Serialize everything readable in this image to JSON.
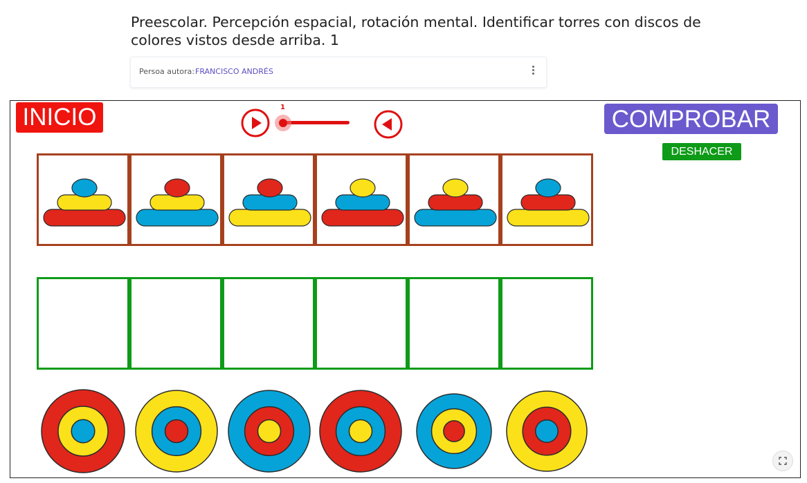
{
  "page": {
    "title": "Preescolar. Percepción espacial, rotación mental. Identificar torres con discos de colores vistos desde arriba. 1",
    "author_label": "Persoa autora:",
    "author_name": "FRANCISCO ANDRÉS"
  },
  "toolbar": {
    "start_label": "INICIO",
    "check_label": "COMPROBAR",
    "undo_label": "DESHACER",
    "slider_value": "1",
    "slider_level": 0
  },
  "colors": {
    "red": "#e1261c",
    "yellow": "#fbe11a",
    "blue": "#06a3d8",
    "tower_border": "#a5411e",
    "drop_border": "#0e9b18",
    "start_button": "#f0140f",
    "check_button": "#6a5acd",
    "undo_button": "#0e9b18"
  },
  "towers": [
    {
      "top": "blue",
      "middle": "yellow",
      "bottom": "red"
    },
    {
      "top": "red",
      "middle": "yellow",
      "bottom": "blue"
    },
    {
      "top": "red",
      "middle": "blue",
      "bottom": "yellow"
    },
    {
      "top": "yellow",
      "middle": "blue",
      "bottom": "red"
    },
    {
      "top": "yellow",
      "middle": "red",
      "bottom": "blue"
    },
    {
      "top": "blue",
      "middle": "red",
      "bottom": "yellow"
    }
  ],
  "top_views": [
    {
      "outer": "red",
      "middle": "yellow",
      "inner": "blue"
    },
    {
      "outer": "yellow",
      "middle": "blue",
      "inner": "red"
    },
    {
      "outer": "blue",
      "middle": "red",
      "inner": "yellow"
    },
    {
      "outer": "red",
      "middle": "blue",
      "inner": "yellow"
    },
    {
      "outer": "blue",
      "middle": "yellow",
      "inner": "red"
    },
    {
      "outer": "yellow",
      "middle": "red",
      "inner": "blue"
    }
  ],
  "icons": {
    "kebab": "more-vert-icon",
    "next": "play-circle-icon",
    "prev": "back-circle-icon",
    "fullscreen": "fullscreen-icon"
  }
}
